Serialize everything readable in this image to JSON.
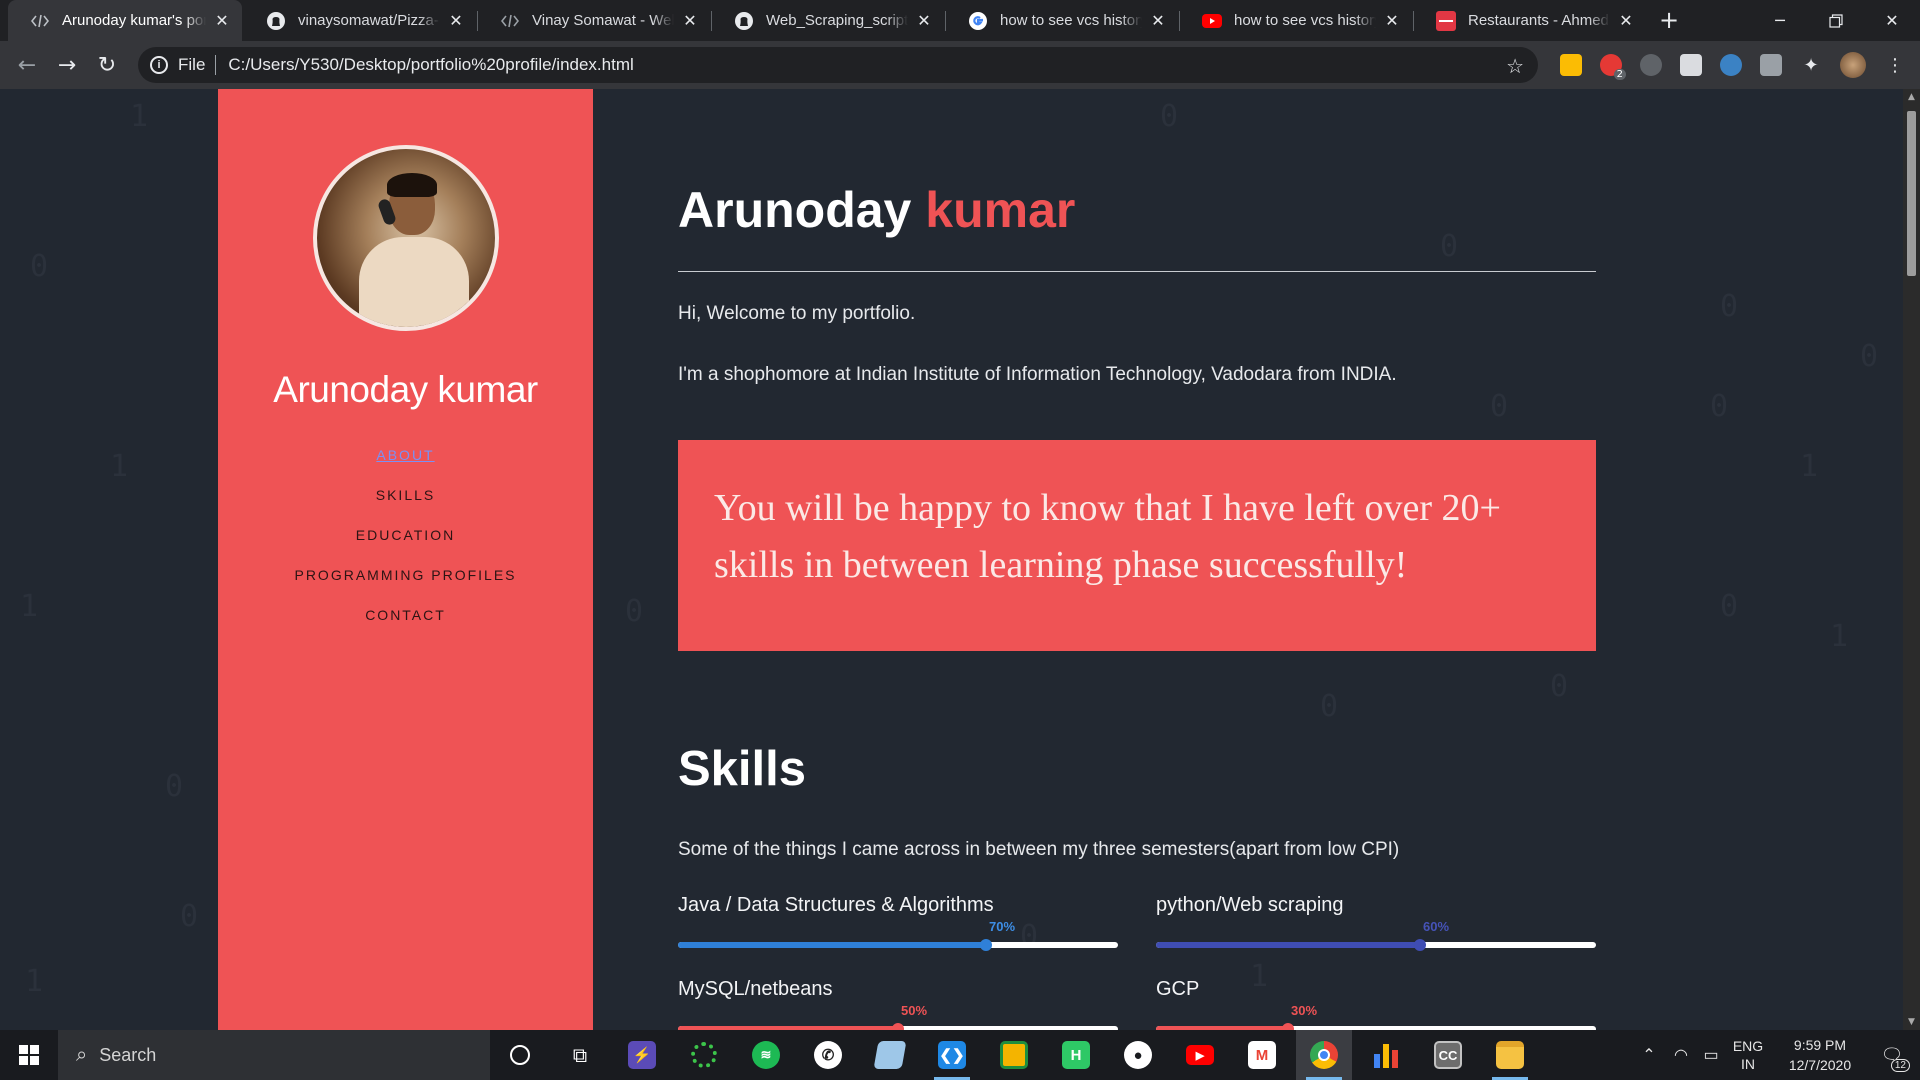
{
  "browser": {
    "tabs": [
      {
        "title": "Arunoday kumar's portfolio",
        "icon": "code-file-icon",
        "active": true
      },
      {
        "title": "vinaysomawat/Pizza-Order",
        "icon": "github-icon",
        "active": false
      },
      {
        "title": "Vinay Somawat - Web Developer",
        "icon": "code-file-icon",
        "active": false
      },
      {
        "title": "Web_Scraping_scripts/",
        "icon": "github-icon",
        "active": false
      },
      {
        "title": "how to see vcs history",
        "icon": "google-icon",
        "active": false
      },
      {
        "title": "how to see vcs history",
        "icon": "youtube-icon",
        "active": false
      },
      {
        "title": "Restaurants - Ahmedabad",
        "icon": "zomato-icon",
        "active": false
      }
    ],
    "new_tab_label": "+",
    "address": {
      "scheme": "File",
      "url": "C:/Users/Y530/Desktop/portfolio%20profile/index.html"
    },
    "extension_badge": "2"
  },
  "sidebar": {
    "name": "Arunoday kumar",
    "nav": [
      {
        "label": "ABOUT",
        "active": true
      },
      {
        "label": "SKILLS",
        "active": false
      },
      {
        "label": "EDUCATION",
        "active": false
      },
      {
        "label": "PROGRAMMING PROFILES",
        "active": false
      },
      {
        "label": "CONTACT",
        "active": false
      }
    ]
  },
  "main": {
    "title_first": "Arunoday",
    "title_accent": "kumar",
    "intro_1": "Hi, Welcome to my portfolio.",
    "intro_2": "I'm a shophomore at Indian Institute of Information Technology, Vadodara from INDIA.",
    "quote": "You will be happy to know that I have left over 20+ skills in between learning phase successfully!",
    "skills_title": "Skills",
    "skills_intro": "Some of the things I came across in between my three semesters(apart from low CPI)",
    "skills": [
      {
        "name": "Java / Data Structures & Algorithms",
        "percent_label": "70%",
        "value": 0.7,
        "color": "#2f80d8",
        "label_color": "#3d8ee6"
      },
      {
        "name": "python/Web scraping",
        "percent_label": "60%",
        "value": 0.6,
        "color": "#3f4db3",
        "label_color": "#4653b8"
      },
      {
        "name": "MySQL/netbeans",
        "percent_label": "50%",
        "value": 0.5,
        "color": "#ef5355",
        "label_color": "#ef5355"
      },
      {
        "name": "GCP",
        "percent_label": "30%",
        "value": 0.3,
        "color": "#ef5355",
        "label_color": "#ef5355"
      }
    ]
  },
  "colors": {
    "accent": "#ef5355",
    "page_background": "#222831",
    "chrome_dark": "#202124"
  },
  "taskbar": {
    "search_placeholder": "Search",
    "apps": [
      "cortana-icon",
      "task-view-icon",
      "app-bolt-icon",
      "app-ring-icon",
      "spotify-icon",
      "whatsapp-icon",
      "app-notes-icon",
      "vscode-icon",
      "google-classroom-icon",
      "hackerrank-icon",
      "github-desktop-icon",
      "youtube-app-icon",
      "gmail-icon",
      "chrome-icon",
      "charts-app-icon",
      "cc-app-icon",
      "file-explorer-icon"
    ],
    "language_top": "ENG",
    "language_bottom": "IN",
    "time": "9:59 PM",
    "date": "12/7/2020",
    "notification_count": "12"
  }
}
